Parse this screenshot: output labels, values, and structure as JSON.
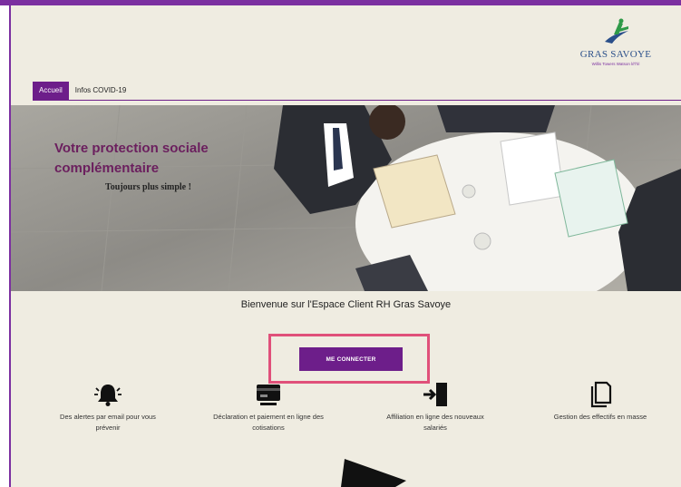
{
  "brand": {
    "name": "GRAS SAVOYE",
    "tagline": "Willis Towers Watson lıl'l'lıl",
    "accent": "#6d1e8a"
  },
  "nav": {
    "tabs": [
      {
        "label": "Accueil",
        "active": true
      },
      {
        "label": "Infos COVID-19",
        "active": false
      }
    ]
  },
  "hero": {
    "title_line1": "Votre protection sociale",
    "title_line2": "complémentaire",
    "subtitle": "Toujours plus simple !"
  },
  "welcome": "Bienvenue sur l'Espace Client RH Gras Savoye",
  "cta": {
    "label": "ME CONNECTER",
    "highlight_color": "#e0507a"
  },
  "features": [
    {
      "icon": "bell-alert-icon",
      "line1": "Des alertes par email pour vous",
      "line2": "prévenir"
    },
    {
      "icon": "credit-card-icon",
      "line1": "Déclaration et paiement en ligne des",
      "line2": "cotisations"
    },
    {
      "icon": "door-enter-icon",
      "line1": "Affiliation en ligne des nouveaux",
      "line2": "salariés"
    },
    {
      "icon": "documents-icon",
      "line1": "Gestion des effectifs en masse",
      "line2": ""
    }
  ]
}
